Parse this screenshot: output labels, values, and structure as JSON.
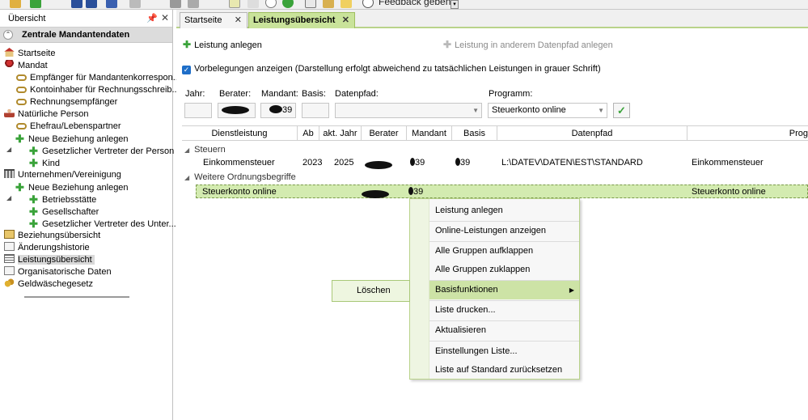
{
  "toolbar": {
    "feedback_label": "Feedback geben"
  },
  "left": {
    "title": "Übersicht",
    "group": "Zentrale Mandantendaten",
    "items": [
      {
        "label": "Startseite",
        "icon": "house-icon"
      },
      {
        "label": "Mandat",
        "icon": "seal-icon"
      },
      {
        "label": "Empfänger für Mandantenkorrespon...",
        "icon": "link-icon"
      },
      {
        "label": "Kontoinhaber für Rechnungsschreib...",
        "icon": "link-icon"
      },
      {
        "label": "Rechnungsempfänger",
        "icon": "link-icon"
      },
      {
        "label": "Natürliche Person",
        "icon": "person-icon"
      },
      {
        "label": "Ehefrau/Lebenspartner",
        "icon": "link-icon"
      },
      {
        "label": "Neue Beziehung anlegen",
        "icon": "plus-icon"
      },
      {
        "label": "Gesetzlicher Vertreter der Person",
        "icon": "plus-icon"
      },
      {
        "label": "Kind",
        "icon": "plus-icon"
      },
      {
        "label": "Unternehmen/Vereinigung",
        "icon": "building-icon"
      },
      {
        "label": "Neue Beziehung anlegen",
        "icon": "plus-icon"
      },
      {
        "label": "Betriebsstätte",
        "icon": "plus-icon"
      },
      {
        "label": "Gesellschafter",
        "icon": "plus-icon"
      },
      {
        "label": "Gesetzlicher Vertreter des Unter...",
        "icon": "plus-icon"
      },
      {
        "label": "Beziehungsübersicht",
        "icon": "book-icon"
      },
      {
        "label": "Änderungshistorie",
        "icon": "doc-icon"
      },
      {
        "label": "Leistungsübersicht",
        "icon": "list-icon"
      },
      {
        "label": "Organisatorische Daten",
        "icon": "doc-icon"
      },
      {
        "label": "Geldwäschegesetz",
        "icon": "coins-icon"
      }
    ]
  },
  "tabs": [
    {
      "label": "Startseite"
    },
    {
      "label": "Leistungsübersicht"
    }
  ],
  "actions": {
    "add_service": "Leistung anlegen",
    "add_service_other_path": "Leistung in anderem Datenpfad anlegen"
  },
  "checkbox": {
    "label": "Vorbelegungen anzeigen (Darstellung erfolgt abweichend zu tatsächlichen Leistungen in grauer Schrift)"
  },
  "filters": {
    "labels": [
      "Jahr:",
      "Berater:",
      "Mandant:",
      "Basis:",
      "Datenpfad:",
      "Programm:"
    ],
    "mandant_suffix": "39",
    "program_value": "Steuerkonto online"
  },
  "grid": {
    "columns": [
      "Dienstleistung",
      "Ab",
      "akt. Jahr",
      "Berater",
      "Mandant",
      "Basis",
      "Datenpfad",
      "Prog"
    ],
    "groups": [
      "Steuern",
      "Weitere Ordnungsbegriffe"
    ],
    "rows": [
      {
        "dienstleistung": "Einkommensteuer",
        "ab": "2023",
        "akt_jahr": "2025",
        "mandant": "39",
        "basis": "39",
        "datenpfad": "L:\\DATEV\\DATEN\\EST\\STANDARD",
        "programm": "Einkommensteuer"
      },
      {
        "dienstleistung": "Steuerkonto online",
        "ab": "",
        "akt_jahr": "",
        "mandant": "39",
        "basis": "",
        "datenpfad": "",
        "programm": "Steuerkonto online"
      }
    ]
  },
  "context_menu": {
    "items": [
      "Leistung anlegen",
      "Online-Leistungen anzeigen",
      "Alle Gruppen aufklappen",
      "Alle Gruppen zuklappen",
      "Basisfunktionen",
      "Liste drucken...",
      "Aktualisieren",
      "Einstellungen Liste...",
      "Liste auf Standard zurücksetzen"
    ],
    "submenu_item": "Löschen"
  },
  "colors": {
    "accent_green": "#c9e39a",
    "menu_highlight": "#cde3a6",
    "selected_row": "#d3ebb0"
  }
}
